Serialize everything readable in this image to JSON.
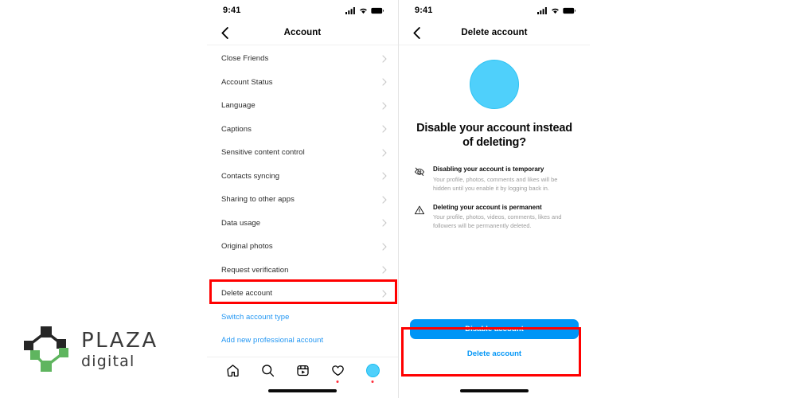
{
  "left_phone": {
    "status_bar": {
      "time": "9:41",
      "icons": [
        "signal-icon",
        "wifi-icon",
        "battery-icon"
      ]
    },
    "nav": {
      "back_icon": "chevron-left-icon",
      "title": "Account"
    },
    "settings_rows": [
      {
        "label": "Close Friends",
        "chevron": "chevron-right-icon"
      },
      {
        "label": "Account Status",
        "chevron": "chevron-right-icon"
      },
      {
        "label": "Language",
        "chevron": "chevron-right-icon"
      },
      {
        "label": "Captions",
        "chevron": "chevron-right-icon"
      },
      {
        "label": "Sensitive content control",
        "chevron": "chevron-right-icon"
      },
      {
        "label": "Contacts syncing",
        "chevron": "chevron-right-icon"
      },
      {
        "label": "Sharing to other apps",
        "chevron": "chevron-right-icon"
      },
      {
        "label": "Data usage",
        "chevron": "chevron-right-icon"
      },
      {
        "label": "Original photos",
        "chevron": "chevron-right-icon"
      },
      {
        "label": "Request verification",
        "chevron": "chevron-right-icon"
      },
      {
        "label": "Delete account",
        "chevron": "chevron-right-icon",
        "highlighted": true
      }
    ],
    "links": [
      {
        "label": "Switch account type"
      },
      {
        "label": "Add new professional account"
      }
    ],
    "tab_bar": [
      {
        "icon": "home-icon",
        "badge": false
      },
      {
        "icon": "search-icon",
        "badge": false
      },
      {
        "icon": "reels-icon",
        "badge": false
      },
      {
        "icon": "heart-icon",
        "badge": true
      },
      {
        "icon": "profile-avatar-icon",
        "badge": true
      }
    ]
  },
  "right_phone": {
    "status_bar": {
      "time": "9:41",
      "icons": [
        "signal-icon",
        "wifi-icon",
        "battery-icon"
      ]
    },
    "nav": {
      "back_icon": "chevron-left-icon",
      "title": "Delete account"
    },
    "headline": "Disable your account instead of deleting?",
    "info_rows": [
      {
        "icon": "eye-slash-icon",
        "title": "Disabling your account is temporary",
        "description": "Your profile, photos, comments and likes will be hidden until you enable it by logging back in."
      },
      {
        "icon": "warning-triangle-icon",
        "title": "Deleting your account is permanent",
        "description": "Your profile, photos, videos, comments, likes and followers will be permanently deleted."
      }
    ],
    "cta": {
      "primary_label": "Disable account",
      "secondary_label": "Delete account"
    }
  },
  "logo": {
    "name": "PLAZA",
    "subtitle": "digital",
    "mark": "diamond-nodes-icon"
  },
  "colors": {
    "accent_blue": "#0095F6",
    "link_blue": "#2196F3",
    "avatar_cyan": "#4FD0FB",
    "highlight_red": "#FF0000",
    "badge_red": "#FF2D3A",
    "logo_green": "#5FB55F",
    "logo_dark": "#262626",
    "muted_text": "#9C9C9C"
  }
}
